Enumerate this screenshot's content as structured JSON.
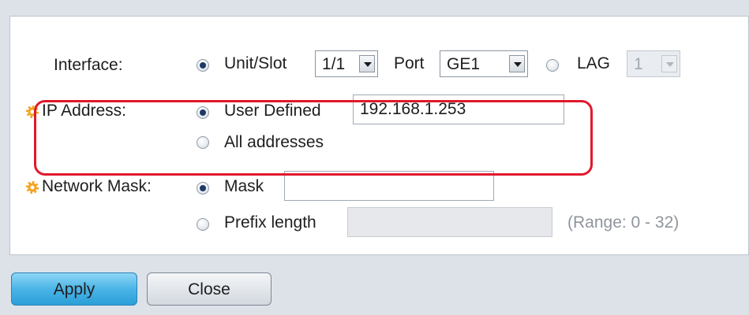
{
  "form": {
    "interface": {
      "label": "Interface:",
      "unit_slot_label": "Unit/Slot",
      "unit_slot_value": "1/1",
      "port_label": "Port",
      "port_value": "GE1",
      "lag_label": "LAG",
      "lag_value": "1",
      "selected": "unit_slot"
    },
    "ip_address": {
      "label": "IP Address:",
      "user_defined_label": "User Defined",
      "user_defined_value": "192.168.1.253",
      "all_addresses_label": "All addresses",
      "selected": "user_defined"
    },
    "network_mask": {
      "label": "Network Mask:",
      "mask_label": "Mask",
      "mask_value": "",
      "prefix_length_label": "Prefix length",
      "prefix_length_value": "",
      "range_hint": "(Range: 0 - 32)",
      "selected": "mask"
    }
  },
  "buttons": {
    "apply": "Apply",
    "close": "Close"
  },
  "colors": {
    "highlight": "#e0192d",
    "required_icon": "#f3a21d",
    "apply_button": "#4ab4e6"
  },
  "icons": {
    "required": "gear-icon"
  }
}
